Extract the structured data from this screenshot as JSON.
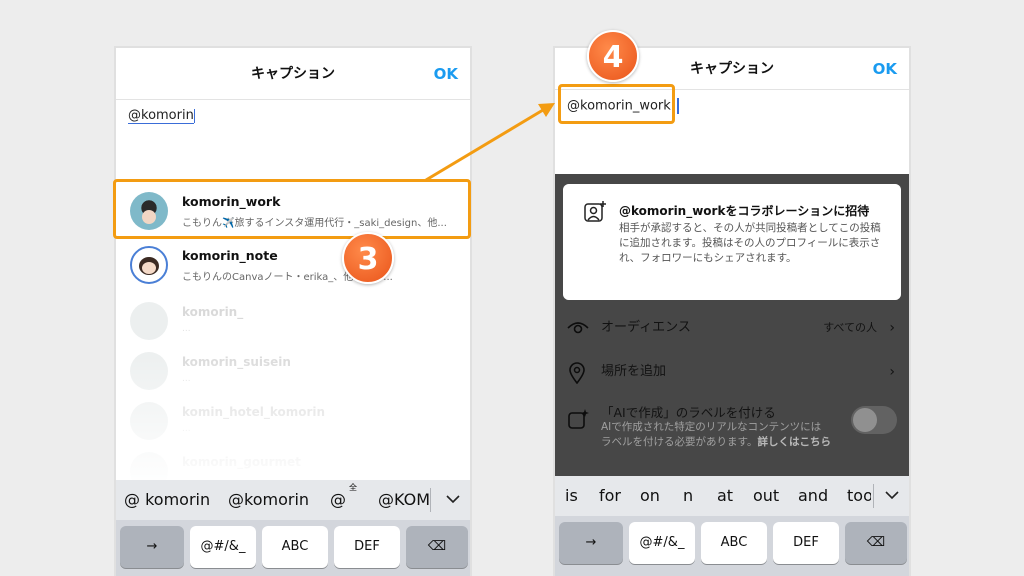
{
  "left": {
    "title": "キャプション",
    "ok": "OK",
    "caption_text": "@komorin",
    "suggestions": [
      {
        "name": "komorin_work",
        "subtitle": "こもりん✈️旅するインスタ運用代行・_saki_design、他..."
      },
      {
        "name": "komorin_note",
        "subtitle": "こもりんのCanvaノート・erika_、他４人が..."
      }
    ],
    "faded_items": [
      {
        "name": "komorin_",
        "subtitle": "..."
      },
      {
        "name": "komorin_suisein",
        "subtitle": "..."
      },
      {
        "name": "komin_hotel_komorin",
        "subtitle": "..."
      },
      {
        "name": "komorin_gourmet",
        "subtitle": ""
      }
    ],
    "predictions": [
      "@ komorin",
      "@komorin",
      "@",
      "@KOM"
    ],
    "pred_small": "全",
    "keys": [
      "→",
      "@#/&_",
      "ABC",
      "DEF",
      "⌫"
    ]
  },
  "right": {
    "title": "キャプション",
    "ok": "OK",
    "caption_text": "@komorin_work",
    "card_title": "@komorin_workをコラボレーションに招待",
    "card_body": "相手が承認すると、その人が共同投稿者としてこの投稿に追加されます。投稿はその人のプロフィールに表示され、フォロワーにもシェアされます。",
    "rows": {
      "audience_label": "オーディエンス",
      "audience_value": "すべての人",
      "location_label": "場所を追加",
      "ai_label": "「AIで作成」のラベルを付ける",
      "ai_desc": "AIで作成された特定のリアルなコンテンツにはラベルを付ける必要があります。",
      "ai_link": "詳しくはこちら"
    },
    "predictions": [
      "is",
      "for",
      "on",
      "n",
      "at",
      "out",
      "and",
      "too"
    ],
    "keys": [
      "→",
      "@#/&_",
      "ABC",
      "DEF",
      "⌫"
    ]
  },
  "badges": {
    "step3": "3",
    "step4": "4"
  },
  "colors": {
    "accent": "#1a9bf0",
    "highlight": "#f39c12",
    "badge": "#e9541a"
  },
  "icons": [
    "avatar-work",
    "avatar-note",
    "add-collaborator-icon",
    "eye-icon",
    "location-pin-icon",
    "ai-label-icon",
    "toggle-switch",
    "chevron-right-icon",
    "backspace-icon",
    "keyboard-dismiss-icon"
  ]
}
